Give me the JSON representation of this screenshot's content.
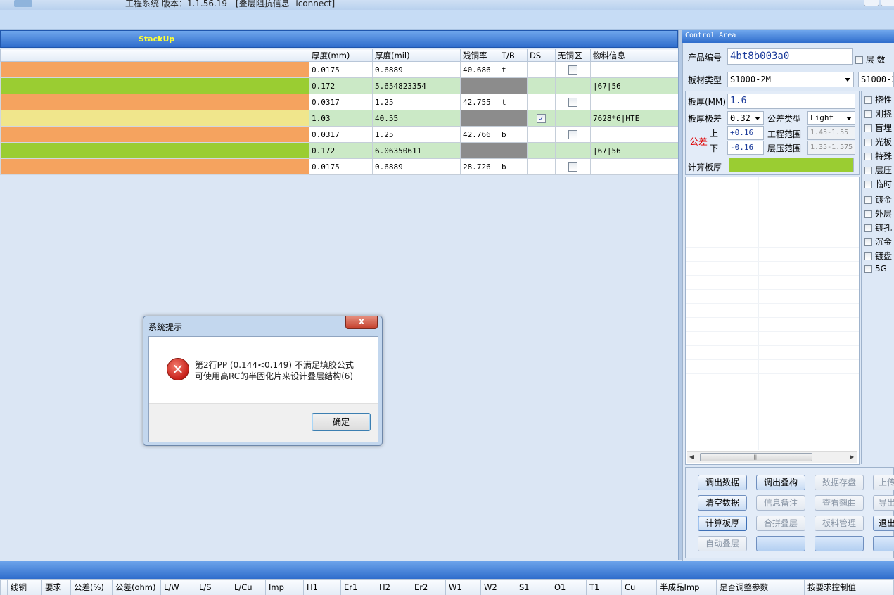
{
  "window": {
    "title": "工程系统   版本：1.1.56.19 - [叠层阻抗信息--iconnect]"
  },
  "stackup": {
    "header": "StackUp",
    "columns": [
      "厚度(mm)",
      "厚度(mil)",
      "残铜率",
      "T/B",
      "DS",
      "无铜区",
      "物料信息"
    ],
    "rows": [
      {
        "color": "#f5a35f",
        "mm": "0.0175",
        "mil": "0.6889",
        "copper": "40.686",
        "tb": "t",
        "ds": "",
        "nocu": false,
        "mat": ""
      },
      {
        "color": "#9acd32",
        "mm": "0.172",
        "mil": "5.654823354",
        "copper": "",
        "tb": "",
        "ds": "",
        "nocu": null,
        "mat": "|67|56"
      },
      {
        "color": "#f5a35f",
        "mm": "0.0317",
        "mil": "1.25",
        "copper": "42.755",
        "tb": "t",
        "ds": "",
        "nocu": false,
        "mat": ""
      },
      {
        "color": "#f0e68c",
        "mm": "1.03",
        "mil": "40.55",
        "copper": "",
        "tb": "",
        "ds": "checked",
        "nocu": null,
        "mat": "7628*6|HTE"
      },
      {
        "color": "#f5a35f",
        "mm": "0.0317",
        "mil": "1.25",
        "copper": "42.766",
        "tb": "b",
        "ds": "",
        "nocu": false,
        "mat": ""
      },
      {
        "color": "#9acd32",
        "mm": "0.172",
        "mil": "6.06350611",
        "copper": "",
        "tb": "",
        "ds": "",
        "nocu": null,
        "mat": "|67|56"
      },
      {
        "color": "#f5a35f",
        "mm": "0.0175",
        "mil": "0.6889",
        "copper": "28.726",
        "tb": "b",
        "ds": "",
        "nocu": false,
        "mat": ""
      }
    ]
  },
  "control": {
    "header": "Control Area",
    "product_label": "产品编号",
    "product_value": "4bt8b003a0",
    "layer_label": "层 数",
    "material_label": "板材类型",
    "material_value": "S1000-2M",
    "material_value2": "S1000-2",
    "thickness_label": "板厚(MM)",
    "thickness_value": "1.6",
    "tol_grade_label": "板厚极差",
    "tol_grade_value": "0.32",
    "tol_type_label": "公差类型",
    "tol_type_value": "Light",
    "tol_label": "公差",
    "upper_label": "上",
    "lower_label": "下",
    "upper_value": "+0.16",
    "lower_value": "-0.16",
    "eng_range_label": "工程范围",
    "eng_range_value": "1.45-1.55",
    "press_range_label": "层压范围",
    "press_range_value": "1.35-1.575",
    "calc_label": "计算板厚",
    "calc_color": "#9acd32",
    "side_options": [
      "挠性",
      "刚挠",
      "盲埋",
      "光板",
      "特殊",
      "层压",
      "临时"
    ],
    "side_options2": [
      "镀金",
      "外层",
      "镀孔",
      "沉金",
      "镀盘",
      "5G"
    ]
  },
  "buttons": [
    [
      "调出数据",
      "调出叠构",
      "数据存盘",
      "上传"
    ],
    [
      "清空数据",
      "信息备注",
      "查看翘曲",
      "导出"
    ],
    [
      "计算板厚",
      "合拼叠层",
      "板料管理",
      "退出"
    ],
    [
      "自动叠层",
      "",
      "",
      ""
    ]
  ],
  "bottom_columns": [
    "线铜",
    "要求",
    "公差(%)",
    "公差(ohm)",
    "L/W",
    "L/S",
    "L/Cu",
    "Imp",
    "H1",
    "Er1",
    "H2",
    "Er2",
    "W1",
    "W2",
    "S1",
    "O1",
    "T1",
    "Cu",
    "半成品Imp",
    "是否调整参数",
    "按要求控制值"
  ],
  "dialog": {
    "title": "系统提示",
    "close": "x",
    "line1": "第2行PP (0.144<0.149) 不满足填胶公式",
    "line2": "可使用高RC的半固化片来设计叠层结构(6)",
    "ok": "确定",
    "icon": "error-icon"
  }
}
